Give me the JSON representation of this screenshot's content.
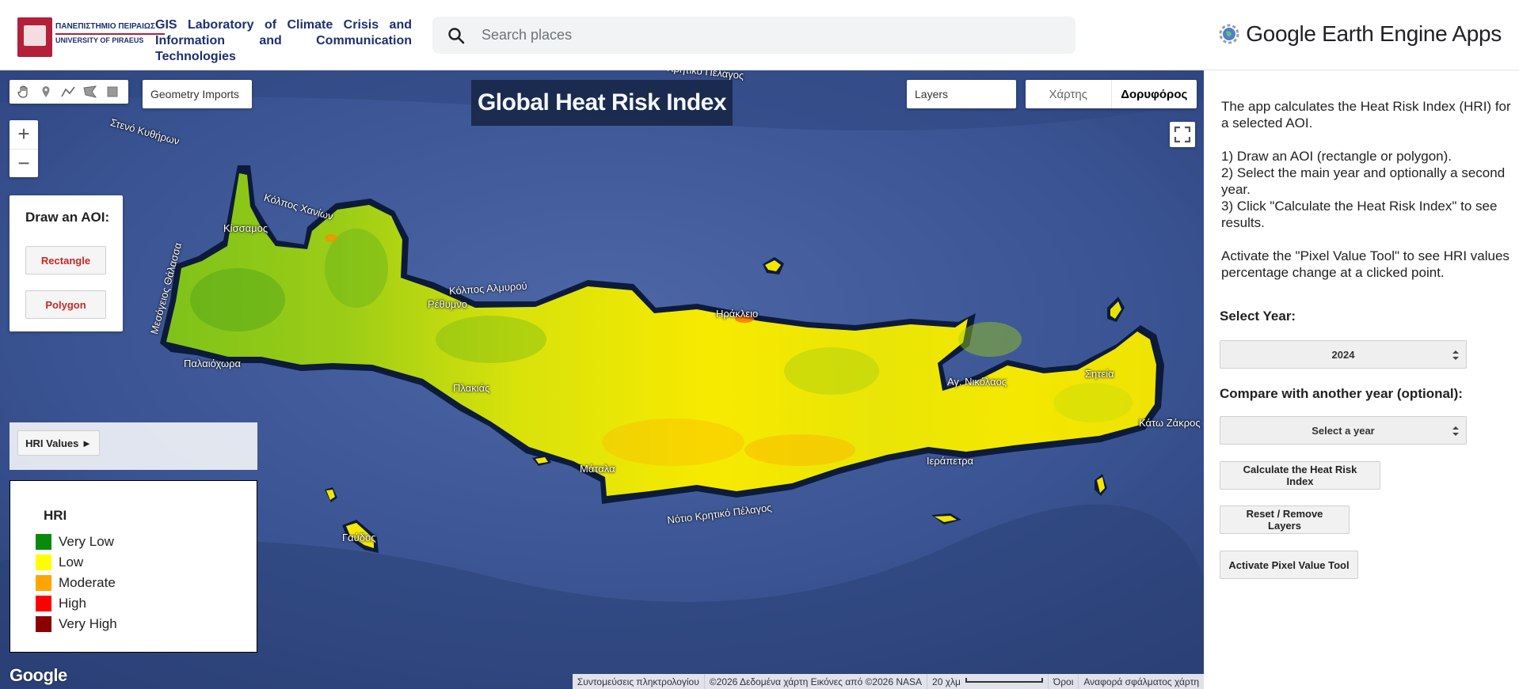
{
  "header": {
    "university_name_gr": "ΠΑΝΕΠΙΣΤΗΜΙΟ ΠΕΙΡΑΙΩΣ",
    "university_name_en": "UNIVERSITY OF PIRAEUS",
    "lab_title": "GIS Laboratory of Climate Crisis and Information and Communication Technologies",
    "search_placeholder": "Search places",
    "brand": "Google Earth Engine Apps"
  },
  "map": {
    "geometry_imports": "Geometry Imports",
    "title": "Global Heat Risk Index",
    "layers_label": "Layers",
    "maptype": [
      "Χάρτης",
      "Δορυφόρος"
    ],
    "maptype_selected": "Δορυφόρος",
    "zoom_in": "+",
    "zoom_out": "−",
    "place_labels": [
      "Στενό Κυθήρων",
      "Κόλπος Χανίων",
      "Κίσσαμος",
      "Κόλπος Αλμυρού",
      "Μεσόγειος Θάλασσα",
      "Παλαιόχωρα",
      "Ρέθυμνο",
      "Ηράκλειο",
      "Πλακιάς",
      "Μάταλα",
      "Νότιο Κρητικό Πέλαγος",
      "Αγ. Νικόλαος",
      "Ιεράπετρα",
      "Σητεία",
      "Γαύδος",
      "Κρητικό Πέλαγος",
      "Κάτω Ζάκρος"
    ],
    "google_logo": "Google",
    "attribution": [
      "Συντομεύσεις πληκτρολογίου",
      "©2026 Δεδομένα χάρτη Εικόνες από ©2026 NASA",
      "20 χλμ",
      "Όροι",
      "Αναφορά σφάλματος χάρτη"
    ]
  },
  "aoi_panel": {
    "title": "Draw an AOI:",
    "rectangle": "Rectangle",
    "polygon": "Polygon"
  },
  "hri_values": {
    "button": "HRI Values ►"
  },
  "legend": {
    "title": "HRI",
    "items": [
      {
        "label": "Very Low",
        "color": "#0a8a0a"
      },
      {
        "label": "Low",
        "color": "#ffff00"
      },
      {
        "label": "Moderate",
        "color": "#ffa500"
      },
      {
        "label": "High",
        "color": "#ff0000"
      },
      {
        "label": "Very High",
        "color": "#8b0000"
      }
    ]
  },
  "side_panel": {
    "intro": "The app calculates the Heat Risk Index (HRI) for a selected AOI.",
    "steps": [
      "1) Draw an AOI (rectangle or polygon).",
      "2) Select the main year and optionally a second year.",
      "3) Click \"Calculate the Heat Risk Index\" to see results."
    ],
    "pixel_note": "Activate the \"Pixel Value Tool\" to see HRI values percentage change at a clicked point.",
    "select_year_label": "Select Year:",
    "selected_year": "2024",
    "compare_label": "Compare with another year (optional):",
    "compare_placeholder": "Select a year",
    "calc_button": "Calculate the Heat Risk Index",
    "reset_button": "Reset / Remove Layers",
    "pixel_button": "Activate Pixel Value Tool"
  }
}
